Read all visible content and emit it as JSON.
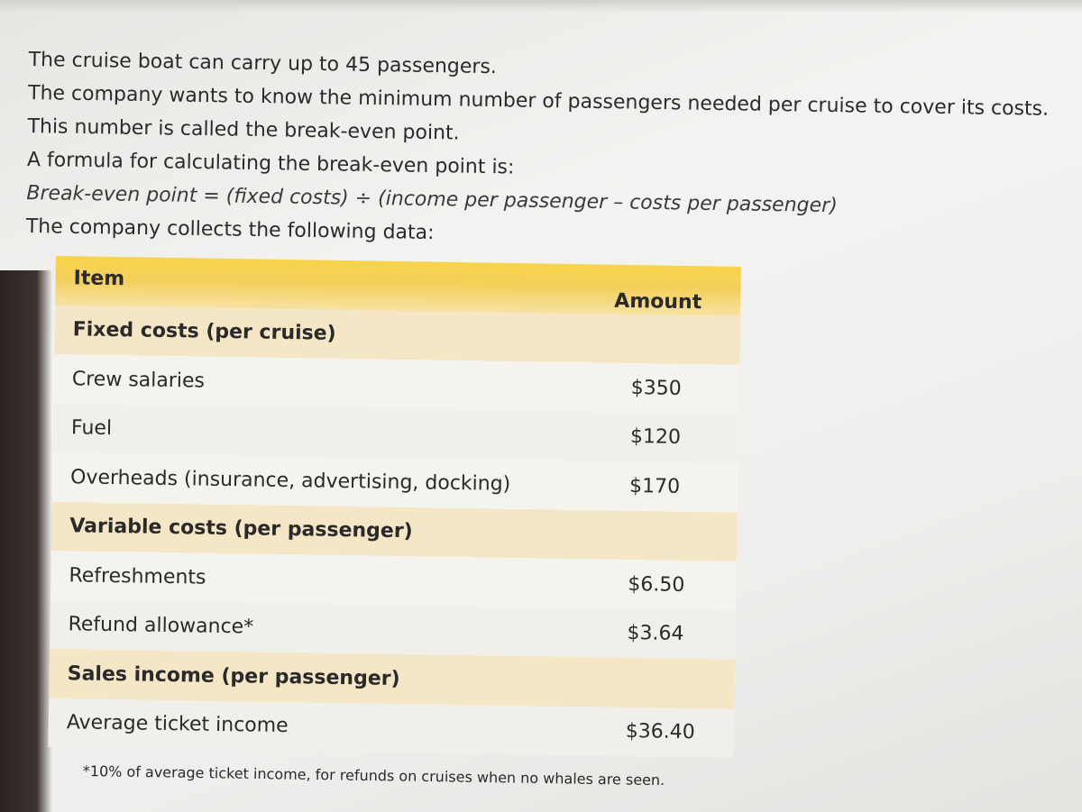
{
  "intro": {
    "lines": [
      "The cruise boat can carry up to 45 passengers.",
      "The company wants to know the minimum number of passengers needed per cruise to cover its costs.",
      "This number is called the break-even point.",
      "A formula for calculating the break-even point is:",
      "Break-even point = (fixed costs) ÷ (income per passenger – costs per passenger)",
      "The company collects the following data:"
    ]
  },
  "table": {
    "header": {
      "item": "Item",
      "amount": "Amount"
    },
    "rows": [
      {
        "type": "section",
        "label": "Fixed costs (per cruise)",
        "amount": ""
      },
      {
        "type": "item",
        "label": "Crew salaries",
        "amount": "$350"
      },
      {
        "type": "item",
        "label": "Fuel",
        "amount": "$120"
      },
      {
        "type": "item",
        "label": "Overheads (insurance, advertising, docking)",
        "amount": "$170"
      },
      {
        "type": "section",
        "label": "Variable costs (per passenger)",
        "amount": ""
      },
      {
        "type": "item",
        "label": "Refreshments",
        "amount": "$6.50"
      },
      {
        "type": "item",
        "label": "Refund allowance*",
        "amount": "$3.64"
      },
      {
        "type": "section",
        "label": "Sales income (per passenger)",
        "amount": ""
      },
      {
        "type": "item",
        "label": "Average ticket income",
        "amount": "$36.40"
      }
    ]
  },
  "footnote": "*10% of average ticket income, for refunds on cruises when no whales are seen."
}
